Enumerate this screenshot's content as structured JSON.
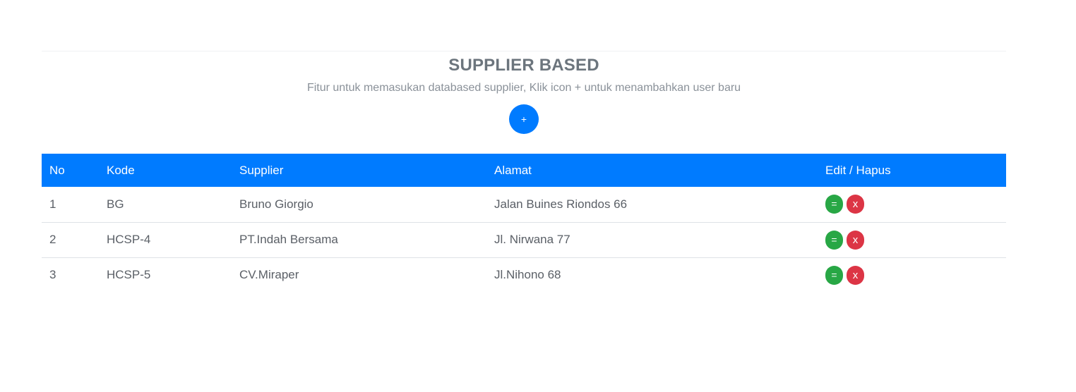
{
  "header": {
    "title": "SUPPLIER BASED",
    "subtitle": "Fitur untuk memasukan databased supplier, Klik icon + untuk menambahkan user baru",
    "add_label": "+"
  },
  "table": {
    "columns": [
      "No",
      "Kode",
      "Supplier",
      "Alamat",
      "Edit / Hapus"
    ],
    "rows": [
      {
        "no": "1",
        "kode": "BG",
        "supplier": "Bruno Giorgio",
        "alamat": "Jalan Buines Riondos 66"
      },
      {
        "no": "2",
        "kode": "HCSP-4",
        "supplier": "PT.Indah Bersama",
        "alamat": "Jl. Nirwana 77"
      },
      {
        "no": "3",
        "kode": "HCSP-5",
        "supplier": "CV.Miraper",
        "alamat": "Jl.Nihono 68"
      }
    ],
    "edit_label": "=",
    "delete_label": "x"
  },
  "colors": {
    "primary": "#007bff",
    "success": "#28a745",
    "danger": "#dc3545",
    "title_text": "#6c757d"
  }
}
